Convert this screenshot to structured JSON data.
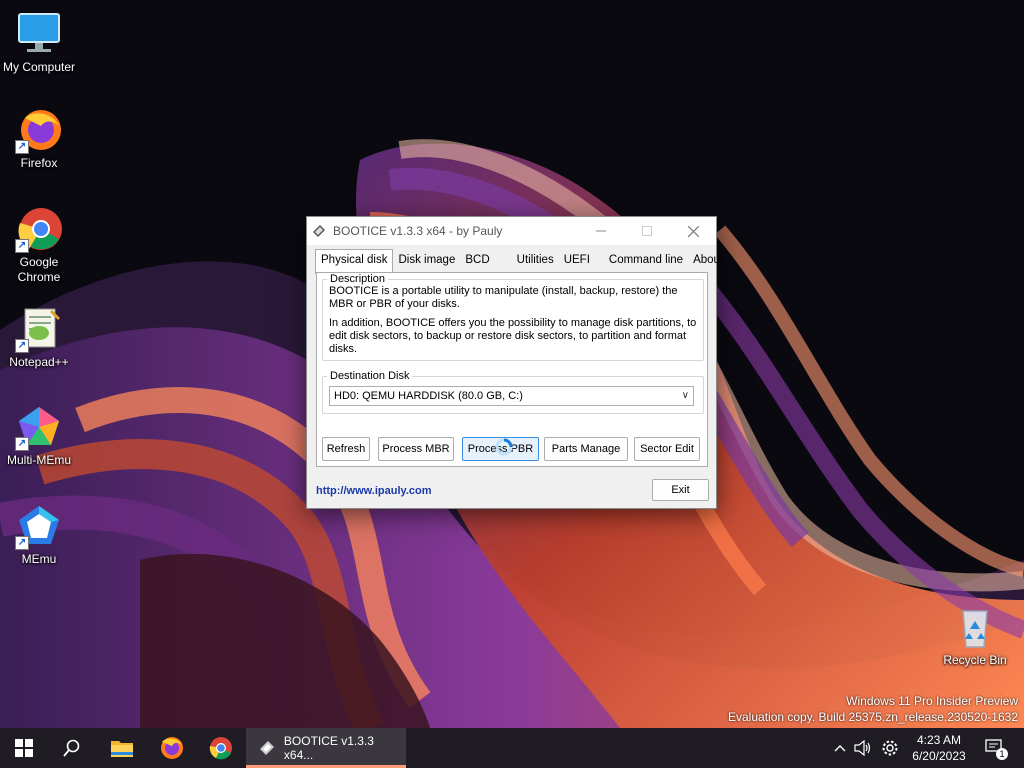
{
  "desktop": {
    "icons": [
      {
        "label": "My Computer"
      },
      {
        "label": "Firefox"
      },
      {
        "label": "Google Chrome"
      },
      {
        "label": "Notepad++"
      },
      {
        "label": "Multi-MEmu"
      },
      {
        "label": "MEmu"
      },
      {
        "label": "Recycle Bin"
      }
    ],
    "watermark": {
      "line1": "Windows 11 Pro Insider Preview",
      "line2": "Evaluation copy. Build 25375.zn_release.230520-1632"
    }
  },
  "dialog": {
    "title": "BOOTICE v1.3.3 x64 - by Pauly",
    "tabs": [
      {
        "label": "Physical disk"
      },
      {
        "label": "Disk image"
      },
      {
        "label": "BCD"
      },
      {
        "label": "Utilities"
      },
      {
        "label": "UEFI"
      },
      {
        "label": "Command line"
      },
      {
        "label": "About"
      }
    ],
    "active_tab": "Physical disk",
    "description": {
      "legend": "Description",
      "para1": "BOOTICE is a portable utility to manipulate (install, backup, restore) the MBR or PBR of your disks.",
      "para2": "In addition, BOOTICE offers you the possibility to manage disk partitions, to edit disk sectors, to backup or restore disk sectors, to partition and format disks."
    },
    "destination": {
      "legend": "Destination Disk",
      "selected": "HD0: QEMU HARDDISK (80.0 GB, C:)"
    },
    "buttons": {
      "refresh": "Refresh",
      "process_mbr": "Process MBR",
      "process_pbr": "Process PBR",
      "parts_manage": "Parts Manage",
      "sector_edit": "Sector Edit",
      "exit": "Exit"
    },
    "link": "http://www.ipauly.com"
  },
  "taskbar": {
    "task_label": "BOOTICE v1.3.3 x64...",
    "time": "4:23 AM",
    "date": "6/20/2023",
    "notification_count": "1"
  },
  "colors": {
    "taskbar_bg": "#1f1c23",
    "accent_hover": "#e5f1fb",
    "link": "#1a3aa8"
  }
}
